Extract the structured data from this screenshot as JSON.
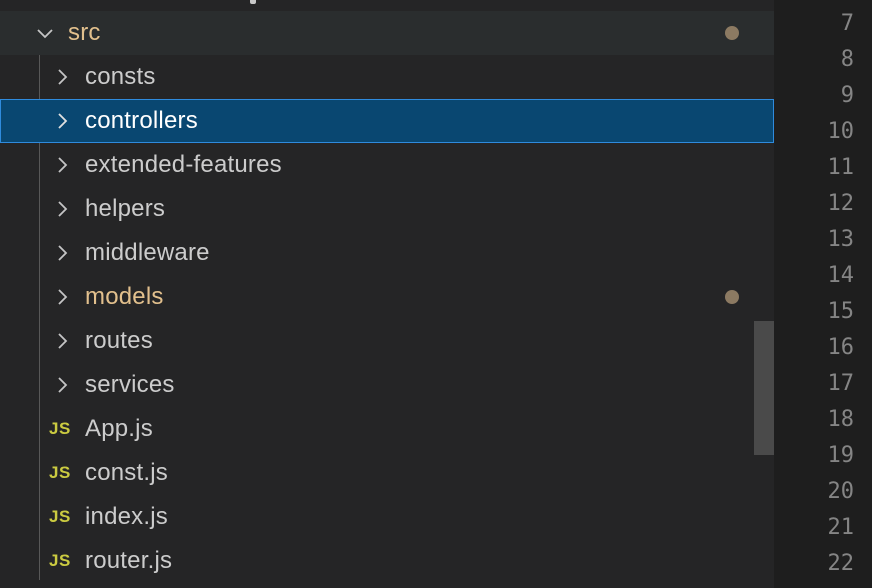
{
  "explorer": {
    "root_folder": {
      "label": "src",
      "expanded": true,
      "has_modification_dot": true
    },
    "items": [
      {
        "type": "folder",
        "label": "consts",
        "expanded": false,
        "modified": false
      },
      {
        "type": "folder",
        "label": "controllers",
        "expanded": false,
        "modified": false,
        "selected": true
      },
      {
        "type": "folder",
        "label": "extended-features",
        "expanded": false,
        "modified": false
      },
      {
        "type": "folder",
        "label": "helpers",
        "expanded": false,
        "modified": false
      },
      {
        "type": "folder",
        "label": "middleware",
        "expanded": false,
        "modified": false
      },
      {
        "type": "folder",
        "label": "models",
        "expanded": false,
        "modified": true
      },
      {
        "type": "folder",
        "label": "routes",
        "expanded": false,
        "modified": false
      },
      {
        "type": "folder",
        "label": "services",
        "expanded": false,
        "modified": false
      },
      {
        "type": "file",
        "label": "App.js",
        "icon_text": "JS"
      },
      {
        "type": "file",
        "label": "const.js",
        "icon_text": "JS"
      },
      {
        "type": "file",
        "label": "index.js",
        "icon_text": "JS"
      },
      {
        "type": "file",
        "label": "router.js",
        "icon_text": "JS"
      }
    ]
  },
  "gutter": {
    "line_numbers": [
      "7",
      "8",
      "9",
      "10",
      "11",
      "12",
      "13",
      "14",
      "15",
      "16",
      "17",
      "18",
      "19",
      "20",
      "21",
      "22"
    ]
  },
  "colors": {
    "sidebar_bg": "#252526",
    "selection_bg": "#094771",
    "selection_border": "#2f8bdd",
    "modified_text": "#e2c08d",
    "js_icon": "#cbcb41",
    "modified_dot": "#8c7a62",
    "editor_bg": "#1e1e1e",
    "line_number": "#858585"
  },
  "icons": {
    "collapsed_folder": "chevron-right-icon",
    "expanded_folder": "chevron-down-icon",
    "js_file": "javascript-file-icon",
    "modified": "modified-dot-icon"
  }
}
